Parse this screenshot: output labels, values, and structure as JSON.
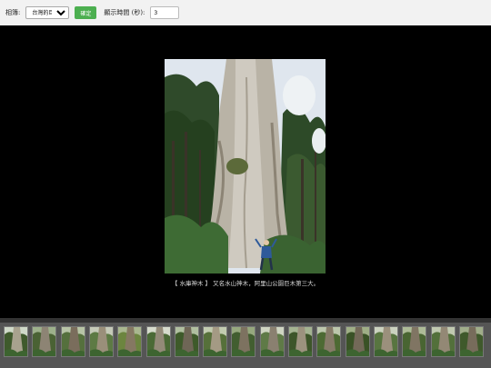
{
  "toolbar": {
    "theme_label": "相簿:",
    "theme_selected": "台灣的巨樹",
    "go_label": "確定",
    "interval_label": "顯示時間 (秒):",
    "interval_value": "3"
  },
  "slideshow": {
    "caption": "【 水庫神木 】 又名水山神木，阿里山公園巨木第三大。"
  },
  "thumbnails": [
    {
      "sky": "#cfd9c8",
      "leaf": "#3f5a2c",
      "trunk": "#a8a28e"
    },
    {
      "sky": "#9db08b",
      "leaf": "#4a6234",
      "trunk": "#8d8474"
    },
    {
      "sky": "#b7c4a6",
      "leaf": "#55703d",
      "trunk": "#7a6d5c"
    },
    {
      "sky": "#c5cab8",
      "leaf": "#5d7a44",
      "trunk": "#9a8f7a"
    },
    {
      "sky": "#a9b78f",
      "leaf": "#6c853f",
      "trunk": "#857862"
    },
    {
      "sky": "#d6dbcc",
      "leaf": "#4b6a36",
      "trunk": "#938a78"
    },
    {
      "sky": "#b0bfa0",
      "leaf": "#3e5a2a",
      "trunk": "#6f6656"
    },
    {
      "sky": "#c2ccb0",
      "leaf": "#56703a",
      "trunk": "#a49a84"
    },
    {
      "sky": "#96a87e",
      "leaf": "#425e30",
      "trunk": "#7d7260"
    },
    {
      "sky": "#cfd5c2",
      "leaf": "#5f7a47",
      "trunk": "#8a8070"
    },
    {
      "sky": "#a4b391",
      "leaf": "#3d5529",
      "trunk": "#9c927e"
    },
    {
      "sky": "#bcc7ac",
      "leaf": "#4d6a33",
      "trunk": "#867b68"
    },
    {
      "sky": "#9fae86",
      "leaf": "#3a5226",
      "trunk": "#736958"
    },
    {
      "sky": "#cbd2bf",
      "leaf": "#587540",
      "trunk": "#9b907c"
    },
    {
      "sky": "#adbb97",
      "leaf": "#496532",
      "trunk": "#807563"
    },
    {
      "sky": "#c0c9b0",
      "leaf": "#53703b",
      "trunk": "#938875"
    },
    {
      "sky": "#a0ad8a",
      "leaf": "#3f592b",
      "trunk": "#776c5b"
    }
  ],
  "colors": {
    "toolbar_bg": "#f2f2f2",
    "go_button": "#4caf50",
    "stage_bg": "#000000",
    "strip_bg": "#555555"
  }
}
